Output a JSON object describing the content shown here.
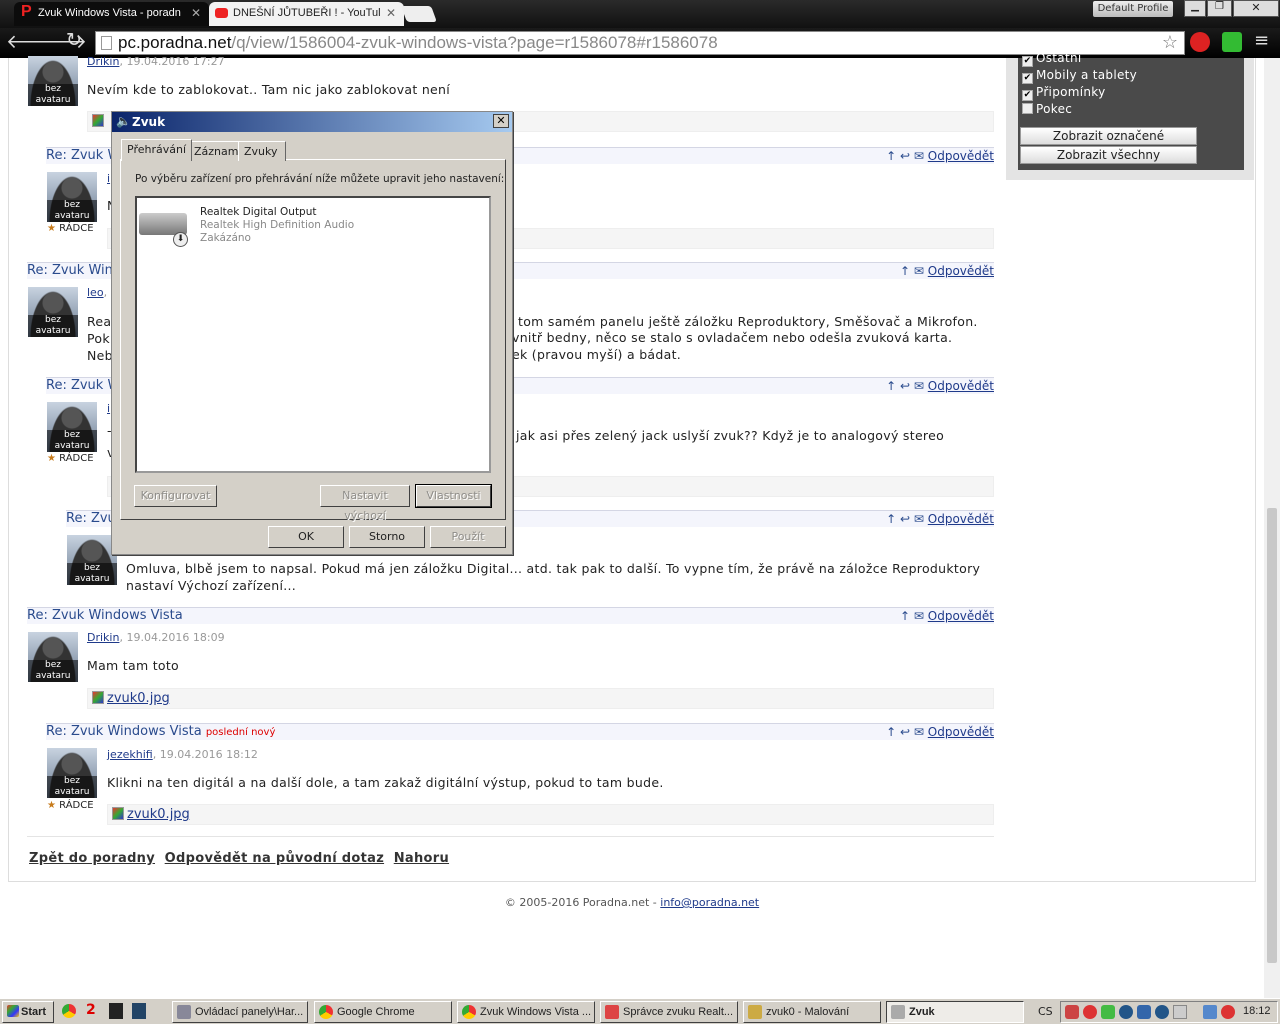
{
  "browser": {
    "tabs": [
      {
        "label": "Zvuk Windows Vista - poradn",
        "icon": "poradna-p-icon"
      },
      {
        "label": "DNEŠNÍ JŮTUBEŘI ! - YouTul",
        "icon": "youtube-icon"
      }
    ],
    "url_host": "pc.poradna.net",
    "url_path": "/q/view/1586004-zvuk-windows-vista?page=r1586078#r1586078",
    "profile": "Default Profile"
  },
  "sidebar": {
    "items": [
      {
        "label": "Ostatní",
        "checked": true
      },
      {
        "label": "Mobily a tablety",
        "checked": true
      },
      {
        "label": "Připomínky",
        "checked": true
      },
      {
        "label": "Pokec",
        "checked": false
      }
    ],
    "show_selected": "Zobrazit označené",
    "show_all": "Zobrazit všechny"
  },
  "common": {
    "reply": "Odpovědět",
    "no_avatar": "bez avataru",
    "advisor": "RÁDCE",
    "thread_title": "Re: Zvuk Windows Vista",
    "title_prefix_1": "Re: Zvuk W",
    "title_prefix_2": "Re: Zvuk Win",
    "title_prefix_3": "Re: Zvuk W",
    "title_prefix_4": "Re: Zvu",
    "latest_new": "poslední nový",
    "attachment": "zvuk0.jpg"
  },
  "posts": {
    "p1": {
      "author": "Drikin",
      "date": ", 19.04.2016 17:27",
      "text": "Nevím kde to zablokovat.. Tam nic jako zablokovat není"
    },
    "p2": {
      "author": "i",
      "text": "N"
    },
    "p3": {
      "author": "leo",
      "date": ",",
      "l1a": "Rea",
      "l1b": "tom samém panelu ještě záložku Reproduktory, Směšovač a Mikrofon.",
      "l2a": "Pok",
      "l2b": "vnitř bedny, něco se stalo s ovladačem nebo odešla zvuková karta.",
      "l3a": "Neb",
      "l3b": "ek (pravou myší) a bádat."
    },
    "p4": {
      "author": "i",
      "l1a": "-",
      "l1b": "jak asi přes zelený jack uslyší zvuk?? Když je to analogový stereo",
      "l2a": "v"
    },
    "p5": {
      "l1": "Omluva, blbě jsem to napsal. Pokud má jen záložku Digital... atd. tak pak to další. To vypne tím, že právě na záložce Reproduktory",
      "l2": "nastaví Výchozí zařízení..."
    },
    "p6": {
      "author": "Drikin",
      "date": ", 19.04.2016 18:09",
      "text": "Mam tam toto"
    },
    "p7": {
      "author": "jezekhifi",
      "date": ", 19.04.2016 18:12",
      "text": "Klikni na ten digitál a na další dole, a tam zakaž digitální výstup, pokud to tam bude."
    }
  },
  "bottom_links": {
    "back": "Zpět do poradny",
    "reply_original": "Odpovědět na původní dotaz",
    "top": "Nahoru"
  },
  "footer": {
    "copyright": "© 2005-2016 Poradna.net - ",
    "email": "info@poradna.net"
  },
  "dialog": {
    "title": "Zvuk",
    "tabs": [
      "Přehrávání",
      "Záznam",
      "Zvuky"
    ],
    "description": "Po výběru zařízení pro přehrávání níže můžete upravit jeho nastavení:",
    "device": {
      "name": "Realtek Digital Output",
      "driver": "Realtek High Definition Audio",
      "status": "Zakázáno"
    },
    "configure": "Konfigurovat",
    "set_default": "Nastavit výchozí",
    "properties": "Vlastnosti",
    "ok": "OK",
    "cancel": "Storno",
    "apply": "Použít"
  },
  "taskbar": {
    "start": "Start",
    "badge": "2",
    "tasks": [
      "Ovládací panely\\Har...",
      "Google Chrome",
      "Zvuk Windows Vista ...",
      "Správce zvuku Realt...",
      "zvuk0 - Malování",
      "Zvuk"
    ],
    "lang": "CS",
    "clock": "18:12"
  }
}
